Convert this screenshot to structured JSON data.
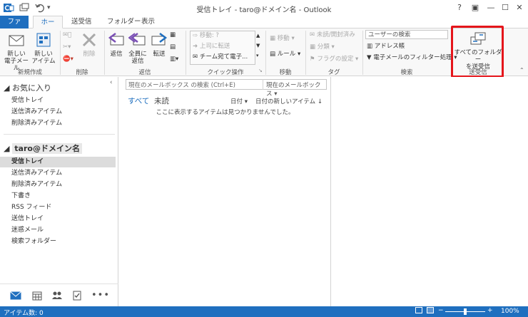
{
  "window": {
    "title": "受信トレイ - taro@ドメイン名 - Outlook",
    "controls": [
      "?",
      "▣",
      "—",
      "☐",
      "✕"
    ]
  },
  "tabs": [
    {
      "label": "ファイル"
    },
    {
      "label": "ホーム"
    },
    {
      "label": "送受信"
    },
    {
      "label": "フォルダー"
    },
    {
      "label": "表示"
    }
  ],
  "ribbon": {
    "new_mail": "新しい\n電子メール",
    "new_items": "新しい\nアイテム",
    "delete": "削除",
    "reply": "返信",
    "reply_all": "全員に\n返信",
    "forward": "転送",
    "quick_move": "移動: ?",
    "quick_to_manager": "上司に転送",
    "quick_team": "チーム宛て電子...",
    "move": "移動",
    "rules": "ルール",
    "unread_read": "未読/開封済み",
    "categorize": "分類",
    "followup": "フラグの設定",
    "search_people_placeholder": "ユーザーの検索",
    "address_book": "アドレス帳",
    "filter_email": "電子メールのフィルター処理",
    "send_receive_all": "すべてのフォルダー\nを送受信",
    "groups": {
      "new": "新規作成",
      "delete": "削除",
      "respond": "返信",
      "quick_steps": "クイック操作",
      "move": "移動",
      "tags": "タグ",
      "find": "検索",
      "send_receive": "送受信"
    }
  },
  "nav": {
    "favorites_title": "お気に入り",
    "favorites": [
      "受信トレイ",
      "送信済みアイテム",
      "削除済みアイテム"
    ],
    "account_title": "taro@ドメイン名",
    "folders": [
      "受信トレイ",
      "送信済みアイテム",
      "削除済みアイテム",
      "下書き",
      "RSS フィード",
      "送信トレイ",
      "迷惑メール",
      "検索フォルダー"
    ],
    "selected_index": 0
  },
  "list": {
    "search_placeholder": "現在のメールボックス の検索 (Ctrl+E)",
    "scope": "現在のメールボックス",
    "filter_all": "すべて",
    "filter_unread": "未読",
    "sort_by": "日付",
    "sort_order": "日付の新しいアイテム",
    "empty_message": "ここに表示するアイテムは見つかりませんでした。"
  },
  "status": {
    "items": "アイテム数: 0",
    "zoom": "100%"
  },
  "colors": {
    "accent": "#1f6fbf",
    "highlight": "#e5151b"
  }
}
